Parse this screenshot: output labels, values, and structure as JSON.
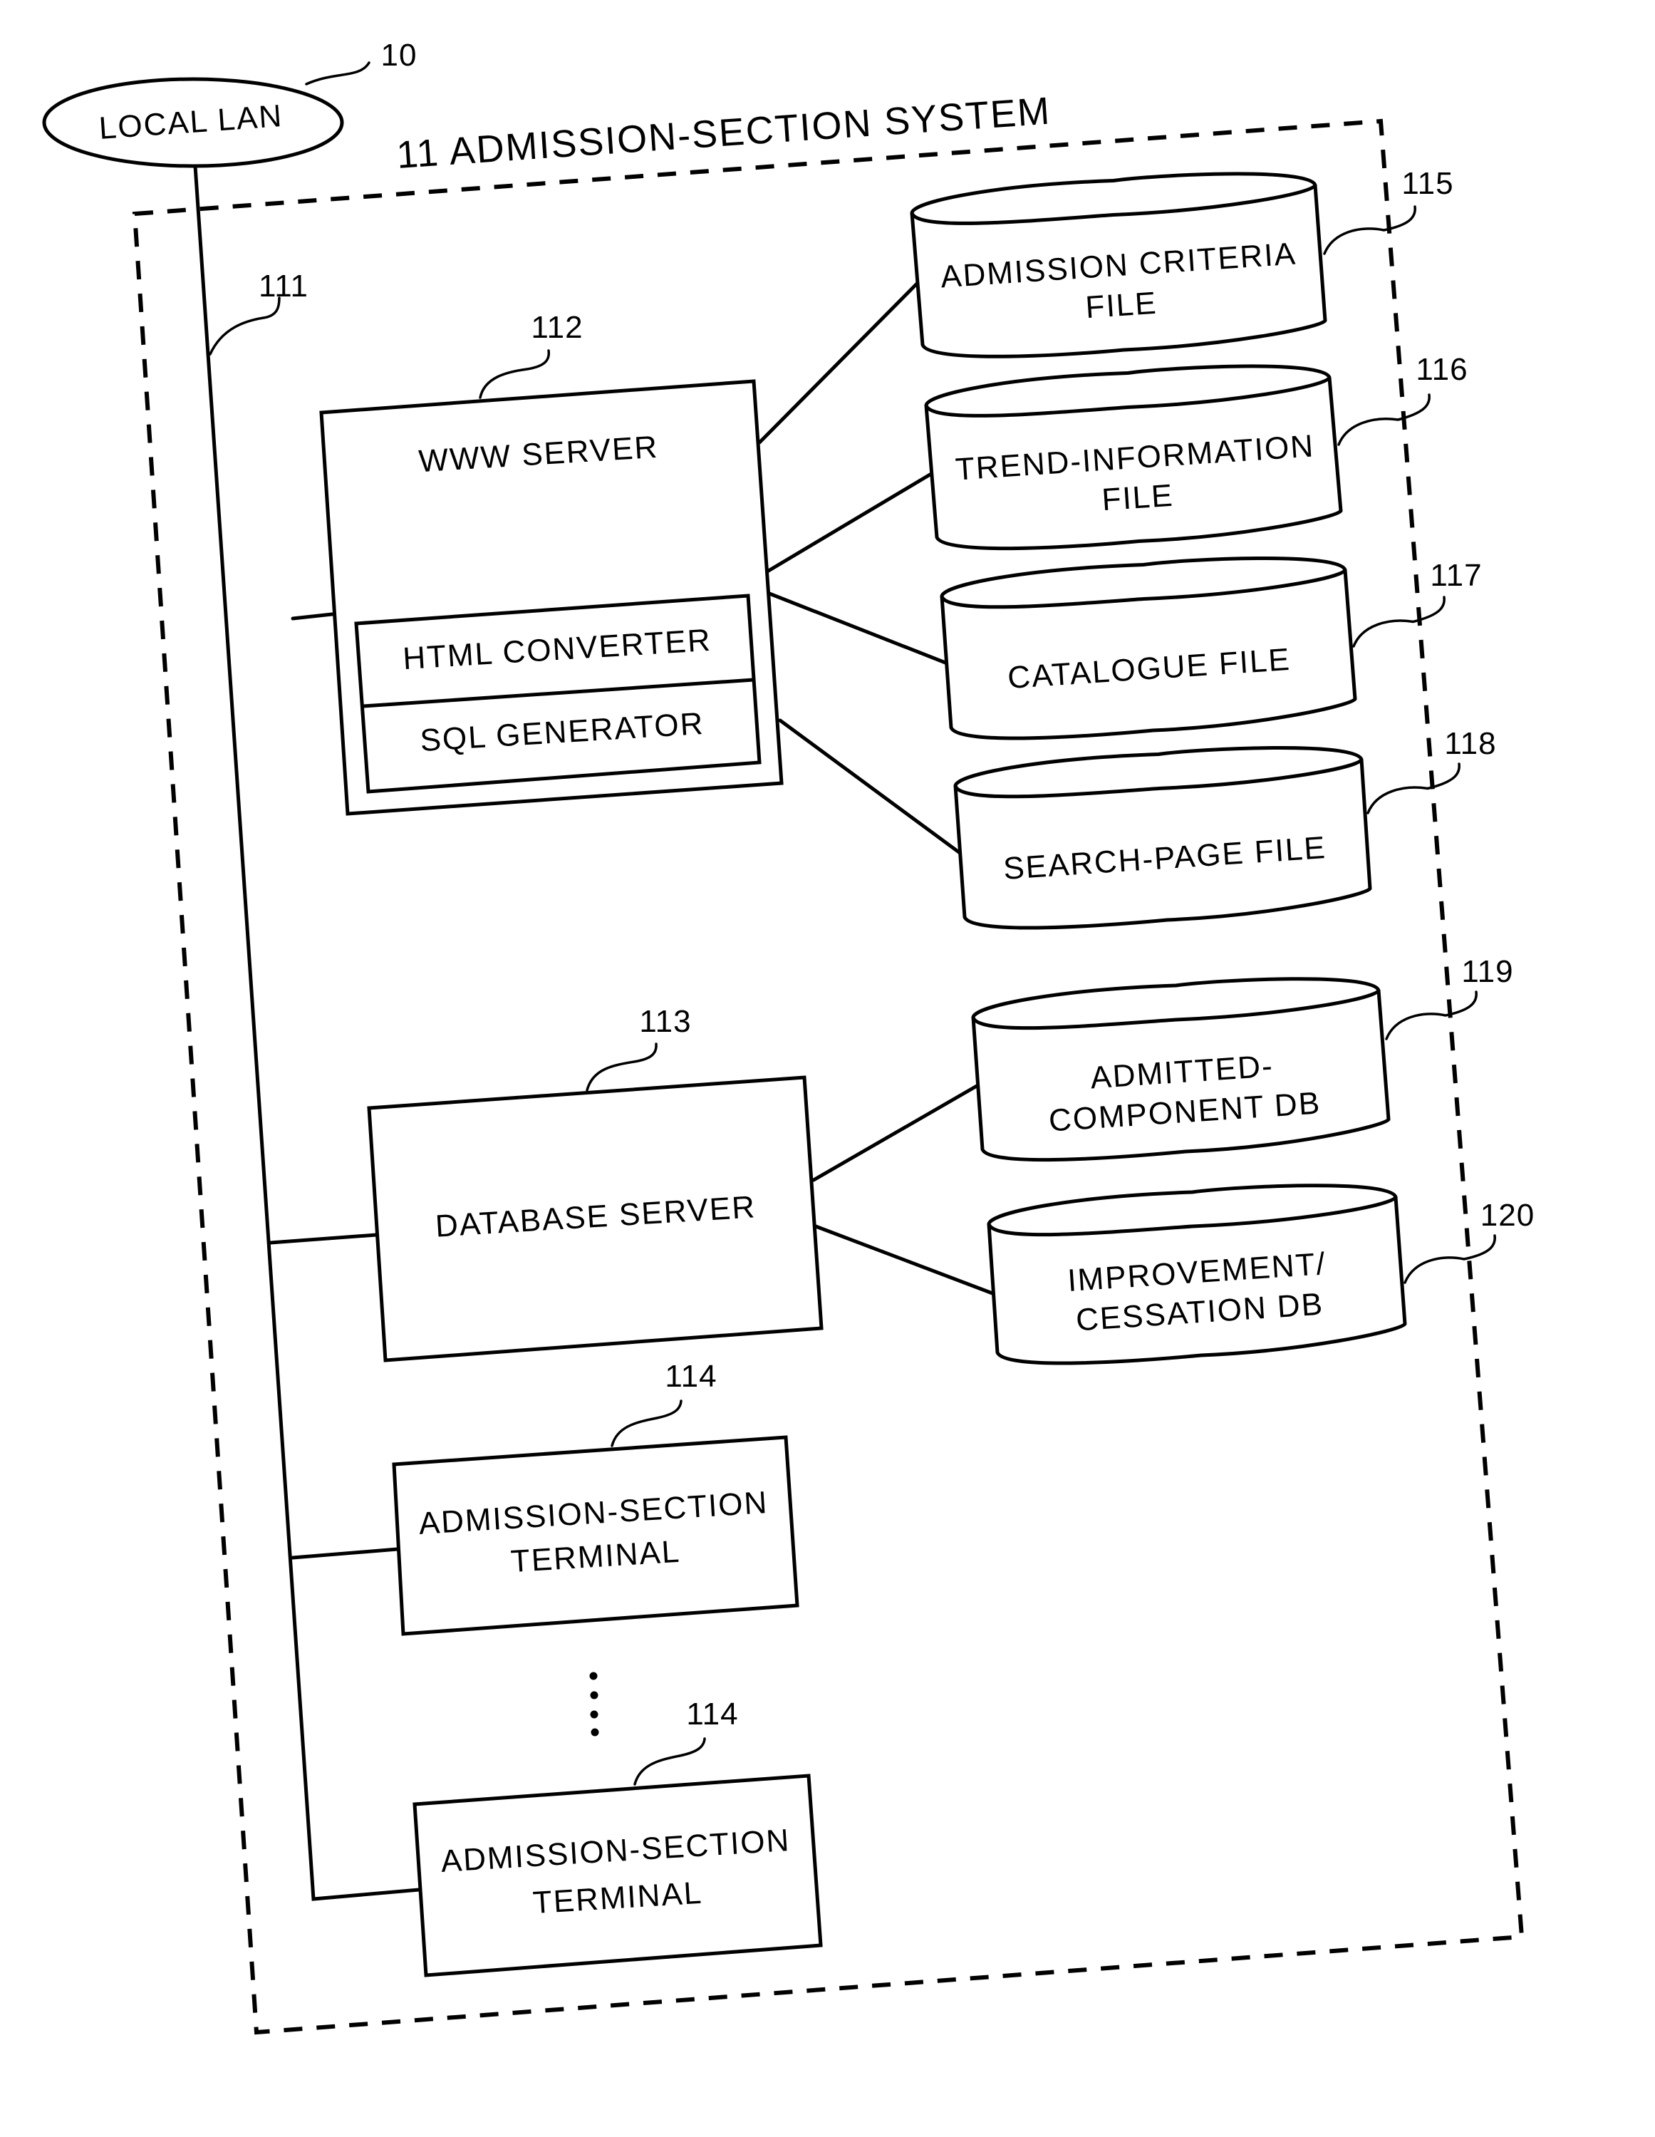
{
  "figure": {
    "network": {
      "label": "LOCAL LAN",
      "ref": "10"
    },
    "system": {
      "title": "11 ADMISSION-SECTION SYSTEM",
      "bus_ref": "111"
    },
    "www_server": {
      "ref": "112",
      "title": "WWW SERVER",
      "modules": [
        "HTML CONVERTER",
        "SQL GENERATOR"
      ]
    },
    "database_server": {
      "ref": "113",
      "title": "DATABASE SERVER"
    },
    "terminals": [
      {
        "ref": "114",
        "lines": [
          "ADMISSION-SECTION",
          "TERMINAL"
        ]
      },
      {
        "ref": "114",
        "lines": [
          "ADMISSION-SECTION",
          "TERMINAL"
        ]
      }
    ],
    "ellipsis": "⋮",
    "files": [
      {
        "ref": "115",
        "lines": [
          "ADMISSION CRITERIA",
          "FILE"
        ],
        "connected_to": "www_server"
      },
      {
        "ref": "116",
        "lines": [
          "TREND-INFORMATION",
          "FILE"
        ],
        "connected_to": "www_server"
      },
      {
        "ref": "117",
        "lines": [
          "CATALOGUE FILE"
        ],
        "connected_to": "www_server"
      },
      {
        "ref": "118",
        "lines": [
          "SEARCH-PAGE FILE"
        ],
        "connected_to": "www_server"
      }
    ],
    "databases": [
      {
        "ref": "119",
        "lines": [
          "ADMITTED-",
          "COMPONENT DB"
        ],
        "connected_to": "database_server"
      },
      {
        "ref": "120",
        "lines": [
          "IMPROVEMENT/",
          "CESSATION DB"
        ],
        "connected_to": "database_server"
      }
    ]
  }
}
